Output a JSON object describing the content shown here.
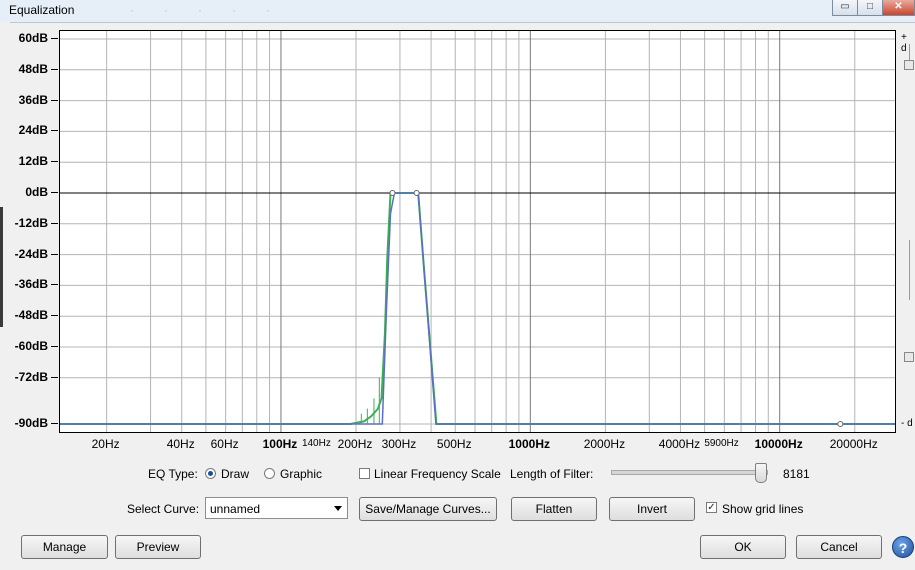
{
  "window": {
    "title": "Equalization",
    "controls": {
      "minimize": "▭",
      "maximize": "□",
      "close": "✕"
    }
  },
  "db_axis": {
    "labels": [
      "60dB",
      "48dB",
      "36dB",
      "24dB",
      "12dB",
      "0dB",
      "-12dB",
      "-24dB",
      "-36dB",
      "-48dB",
      "-60dB",
      "-72dB",
      "-90dB"
    ],
    "values": [
      60,
      48,
      36,
      24,
      12,
      0,
      -12,
      -24,
      -36,
      -48,
      -60,
      -72,
      -90
    ],
    "bold": [
      true,
      true,
      false,
      false,
      false,
      true,
      false,
      false,
      false,
      true,
      false,
      false,
      true
    ],
    "range": [
      -90,
      60
    ]
  },
  "freq_axis": {
    "labels": [
      {
        "text": "20Hz",
        "hz": 20,
        "bold": false,
        "small": false
      },
      {
        "text": "40Hz",
        "hz": 40,
        "bold": false,
        "small": false
      },
      {
        "text": "60Hz",
        "hz": 60,
        "bold": false,
        "small": false
      },
      {
        "text": "100Hz",
        "hz": 100,
        "bold": true,
        "small": false
      },
      {
        "text": "140Hz",
        "hz": 140,
        "bold": false,
        "small": true
      },
      {
        "text": "200Hz",
        "hz": 200,
        "bold": false,
        "small": false
      },
      {
        "text": "300Hz",
        "hz": 300,
        "bold": false,
        "small": false
      },
      {
        "text": "500Hz",
        "hz": 500,
        "bold": false,
        "small": false
      },
      {
        "text": "1000Hz",
        "hz": 1000,
        "bold": true,
        "small": false
      },
      {
        "text": "2000Hz",
        "hz": 2000,
        "bold": false,
        "small": false
      },
      {
        "text": "4000Hz",
        "hz": 4000,
        "bold": false,
        "small": false
      },
      {
        "text": "5900Hz",
        "hz": 5900,
        "bold": false,
        "small": true
      },
      {
        "text": "10000Hz",
        "hz": 10000,
        "bold": true,
        "small": false
      },
      {
        "text": "20000Hz",
        "hz": 20000,
        "bold": false,
        "small": false
      }
    ],
    "range_hz": [
      13,
      29000
    ]
  },
  "right_axis": {
    "plus_label": "+ d",
    "minus_label": "- d"
  },
  "chart_data": {
    "type": "line",
    "x_scale": "log",
    "xlabel": "",
    "ylabel": "",
    "ylim": [
      -90,
      60
    ],
    "grid": true,
    "series": [
      {
        "color": "#3cb050",
        "x": [
          13,
          190,
          215,
          230,
          245,
          253,
          261,
          267,
          275,
          285,
          345,
          355,
          375,
          420,
          29000
        ],
        "y": [
          -90,
          -90,
          -89,
          -87,
          -84,
          -80,
          -55,
          -25,
          0,
          0,
          0,
          0,
          -30,
          -90,
          -90
        ]
      },
      {
        "color": "#5a6fc4",
        "x": [
          13,
          255,
          265,
          275,
          285,
          345,
          355,
          375,
          418,
          29000
        ],
        "y": [
          -90,
          -90,
          -45,
          -8,
          0,
          0,
          0,
          -30,
          -90,
          -90
        ]
      }
    ],
    "control_points": [
      {
        "hz": 280,
        "db": 0
      },
      {
        "hz": 350,
        "db": 0
      },
      {
        "hz": 17500,
        "db": -90
      }
    ],
    "colors": {
      "zero_line": "#000000",
      "grid": "#b4b4b4",
      "curve": "#3cb050",
      "curve_inner": "#5a6fc4"
    }
  },
  "controls": {
    "eq_type_label": "EQ Type:",
    "draw_label": "Draw",
    "graphic_label": "Graphic",
    "eq_type_selected": "Draw",
    "linear_freq_label": "Linear Frequency Scale",
    "linear_freq_checked": false,
    "filter_length_label": "Length of Filter:",
    "filter_length_value": "8181",
    "filter_length_fraction": 0.94,
    "select_curve_label": "Select Curve:",
    "select_curve_value": "unnamed",
    "save_manage_label": "Save/Manage Curves...",
    "flatten_label": "Flatten",
    "invert_label": "Invert",
    "show_grid_label": "Show grid lines",
    "show_grid_checked": true,
    "check_mark": "✓"
  },
  "footer": {
    "manage_label": "Manage",
    "preview_label": "Preview",
    "ok_label": "OK",
    "cancel_label": "Cancel",
    "help_label": "?"
  }
}
